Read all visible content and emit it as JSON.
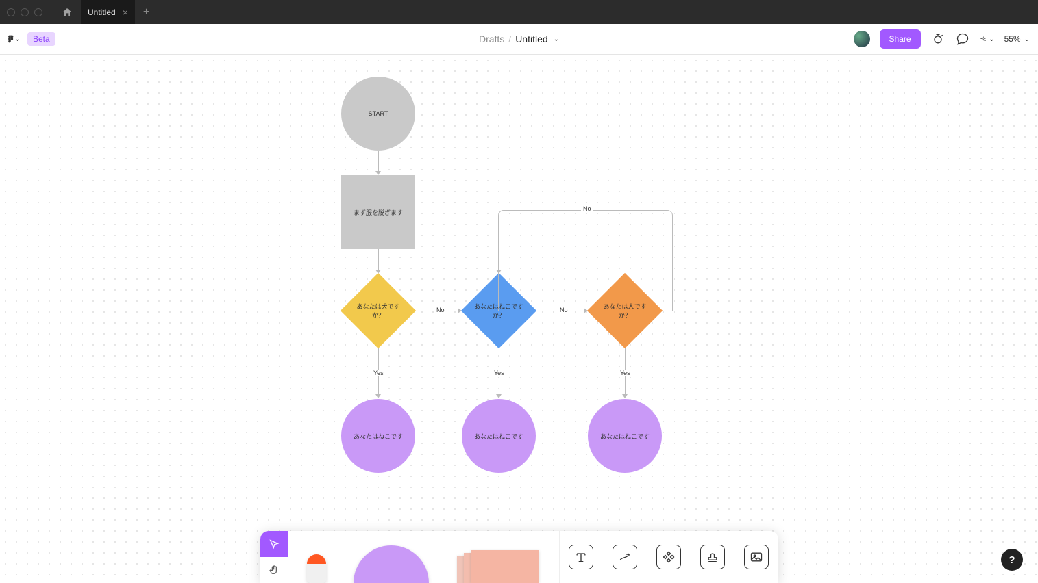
{
  "titlebar": {
    "tab_title": "Untitled"
  },
  "header": {
    "badge": "Beta",
    "breadcrumb_parent": "Drafts",
    "breadcrumb_title": "Untitled",
    "share_label": "Share",
    "zoom": "55%"
  },
  "flowchart": {
    "start": "START",
    "step1": "まず服を脱ぎます",
    "q1": "あなたは犬ですか？",
    "q2": "あなたはねこですか？",
    "q3": "あなたは人ですか？",
    "yes": "Yes",
    "no": "No",
    "result1": "あなたはねこです",
    "result2": "あなたはねこです",
    "result3": "あなたはねこです"
  },
  "help": "?"
}
